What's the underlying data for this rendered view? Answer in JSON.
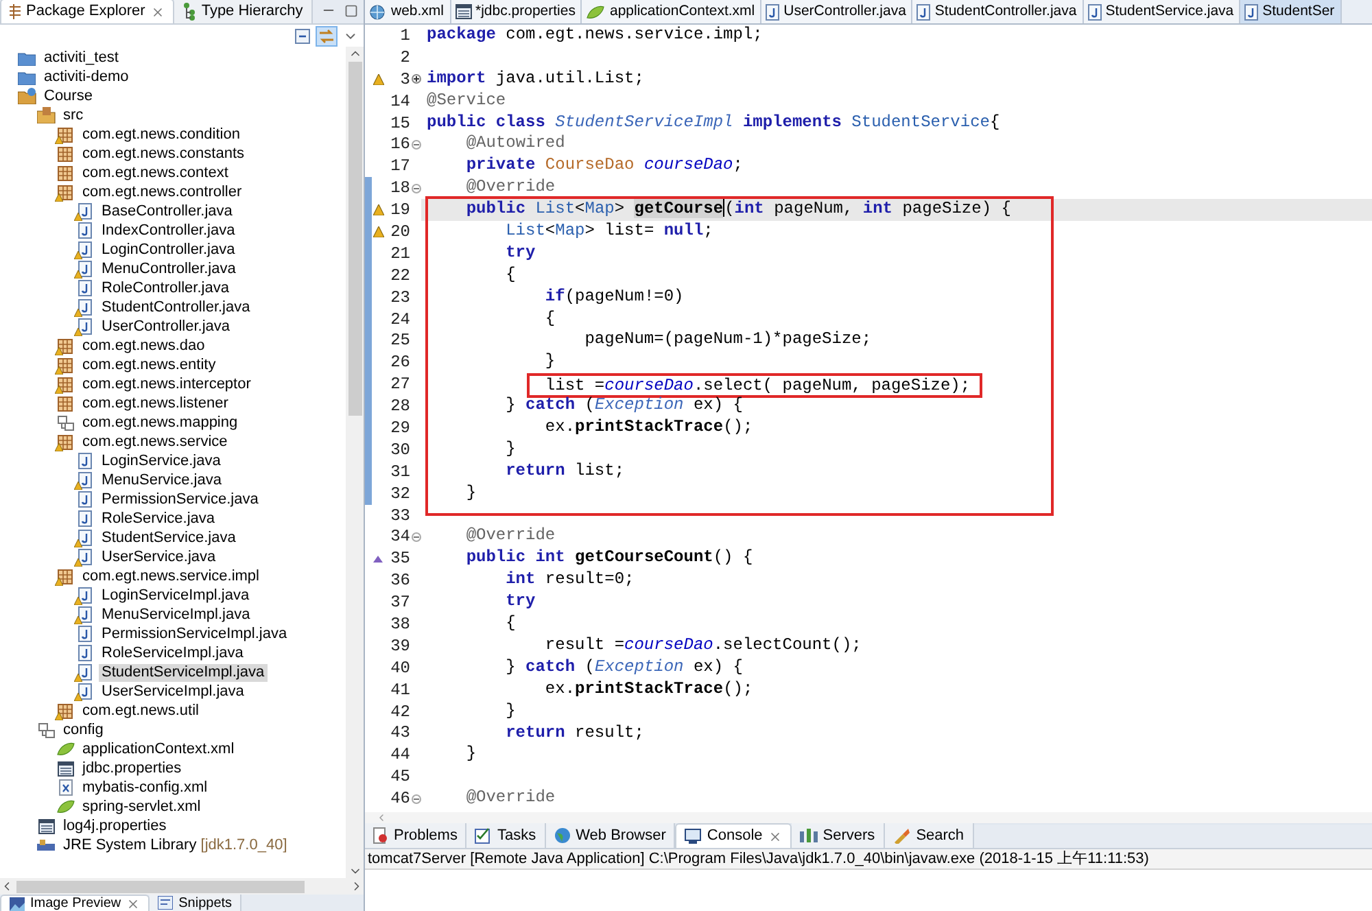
{
  "explorer": {
    "tabs": [
      {
        "label": "Package Explorer",
        "kind": "explorer",
        "selected": true,
        "closable": true
      },
      {
        "label": "Type Hierarchy",
        "kind": "hierarchy",
        "selected": false,
        "closable": false
      }
    ],
    "link_with_editor": true,
    "tree": [
      {
        "label": "activiti_test",
        "kind": "project",
        "selected": false
      },
      {
        "label": "activiti-demo",
        "kind": "project",
        "selected": false
      },
      {
        "label": "Course",
        "kind": "java_project",
        "selected": false,
        "children": [
          {
            "label": "src",
            "kind": "source_folder",
            "selected": false,
            "children": [
              {
                "label": "com.egt.news.condition",
                "kind": "package",
                "warning": true,
                "selected": false
              },
              {
                "label": "com.egt.news.constants",
                "kind": "package",
                "warning": false,
                "selected": false
              },
              {
                "label": "com.egt.news.context",
                "kind": "package",
                "warning": false,
                "selected": false
              },
              {
                "label": "com.egt.news.controller",
                "kind": "package",
                "warning": true,
                "selected": false,
                "children": [
                  {
                    "label": "BaseController.java",
                    "kind": "java",
                    "warning": true,
                    "selected": false
                  },
                  {
                    "label": "IndexController.java",
                    "kind": "java",
                    "warning": false,
                    "selected": false
                  },
                  {
                    "label": "LoginController.java",
                    "kind": "java",
                    "warning": true,
                    "selected": false
                  },
                  {
                    "label": "MenuController.java",
                    "kind": "java",
                    "warning": true,
                    "selected": false
                  },
                  {
                    "label": "RoleController.java",
                    "kind": "java",
                    "warning": false,
                    "selected": false
                  },
                  {
                    "label": "StudentController.java",
                    "kind": "java",
                    "warning": true,
                    "selected": false
                  },
                  {
                    "label": "UserController.java",
                    "kind": "java",
                    "warning": true,
                    "selected": false
                  }
                ]
              },
              {
                "label": "com.egt.news.dao",
                "kind": "package",
                "warning": true,
                "selected": false
              },
              {
                "label": "com.egt.news.entity",
                "kind": "package",
                "warning": true,
                "selected": false
              },
              {
                "label": "com.egt.news.interceptor",
                "kind": "package",
                "warning": true,
                "selected": false
              },
              {
                "label": "com.egt.news.listener",
                "kind": "package",
                "warning": false,
                "selected": false
              },
              {
                "label": "com.egt.news.mapping",
                "kind": "folder",
                "selected": false
              },
              {
                "label": "com.egt.news.service",
                "kind": "package",
                "warning": true,
                "selected": false,
                "children": [
                  {
                    "label": "LoginService.java",
                    "kind": "java",
                    "warning": false,
                    "selected": false
                  },
                  {
                    "label": "MenuService.java",
                    "kind": "java",
                    "warning": true,
                    "selected": false
                  },
                  {
                    "label": "PermissionService.java",
                    "kind": "java",
                    "warning": false,
                    "selected": false
                  },
                  {
                    "label": "RoleService.java",
                    "kind": "java",
                    "warning": false,
                    "selected": false
                  },
                  {
                    "label": "StudentService.java",
                    "kind": "java",
                    "warning": true,
                    "selected": false
                  },
                  {
                    "label": "UserService.java",
                    "kind": "java",
                    "warning": true,
                    "selected": false
                  }
                ]
              },
              {
                "label": "com.egt.news.service.impl",
                "kind": "package",
                "warning": true,
                "selected": false,
                "children": [
                  {
                    "label": "LoginServiceImpl.java",
                    "kind": "java",
                    "warning": true,
                    "selected": false
                  },
                  {
                    "label": "MenuServiceImpl.java",
                    "kind": "java",
                    "warning": true,
                    "selected": false
                  },
                  {
                    "label": "PermissionServiceImpl.java",
                    "kind": "java",
                    "warning": false,
                    "selected": false
                  },
                  {
                    "label": "RoleServiceImpl.java",
                    "kind": "java",
                    "warning": false,
                    "selected": false
                  },
                  {
                    "label": "StudentServiceImpl.java",
                    "kind": "java",
                    "warning": true,
                    "selected": true
                  },
                  {
                    "label": "UserServiceImpl.java",
                    "kind": "java",
                    "warning": true,
                    "selected": false
                  }
                ]
              },
              {
                "label": "com.egt.news.util",
                "kind": "package",
                "warning": true,
                "selected": false
              }
            ]
          },
          {
            "label": "config",
            "kind": "folder",
            "selected": false,
            "children": [
              {
                "label": "applicationContext.xml",
                "kind": "spring",
                "selected": false
              },
              {
                "label": "jdbc.properties",
                "kind": "properties",
                "selected": false
              },
              {
                "label": "mybatis-config.xml",
                "kind": "xml",
                "selected": false
              },
              {
                "label": "spring-servlet.xml",
                "kind": "spring",
                "selected": false
              }
            ]
          },
          {
            "label": "log4j.properties",
            "kind": "properties",
            "selected": false
          },
          {
            "label": "JRE System Library",
            "decoration": "[jdk1.7.0_40]",
            "kind": "library",
            "selected": false
          }
        ]
      }
    ]
  },
  "editor": {
    "tabs": [
      {
        "label": "web.xml",
        "kind": "web",
        "selected": false
      },
      {
        "label": "*jdbc.properties",
        "kind": "properties",
        "selected": false
      },
      {
        "label": "applicationContext.xml",
        "kind": "spring",
        "selected": false
      },
      {
        "label": "UserController.java",
        "kind": "java",
        "selected": false
      },
      {
        "label": "StudentController.java",
        "kind": "java",
        "selected": false
      },
      {
        "label": "StudentService.java",
        "kind": "java",
        "selected": false
      },
      {
        "label": "StudentSer",
        "kind": "java",
        "selected": true
      }
    ],
    "lines": [
      {
        "number": "1",
        "warning": false,
        "override": false,
        "changed": false,
        "current": false,
        "in_box": false,
        "boxed": false,
        "tokens": [
          {
            "kind": "kw",
            "text": "package"
          },
          {
            "kind": "plain",
            "text": " com.egt.news.service.impl;"
          }
        ]
      },
      {
        "number": "2",
        "warning": false,
        "override": false,
        "changed": false,
        "current": false,
        "in_box": false,
        "boxed": false
      },
      {
        "number": "3",
        "warning": true,
        "override": false,
        "collapsed": true,
        "changed": false,
        "current": false,
        "in_box": false,
        "boxed": false,
        "tokens": [
          {
            "kind": "kw",
            "text": "import"
          },
          {
            "kind": "plain",
            "text": " java.util.List;"
          }
        ]
      },
      {
        "number": "14",
        "warning": false,
        "override": false,
        "changed": false,
        "current": false,
        "in_box": false,
        "boxed": false,
        "tokens": [
          {
            "kind": "ann",
            "text": "@Service"
          }
        ]
      },
      {
        "number": "15",
        "warning": false,
        "override": false,
        "changed": false,
        "current": false,
        "in_box": false,
        "boxed": false,
        "tokens": [
          {
            "kind": "kw",
            "text": "public class "
          },
          {
            "kind": "type_italic",
            "text": "StudentServiceImpl "
          },
          {
            "kind": "kw",
            "text": "implements "
          },
          {
            "kind": "type",
            "text": "StudentService"
          },
          {
            "kind": "plain",
            "text": "{"
          }
        ]
      },
      {
        "number": "16",
        "warning": false,
        "override": false,
        "collapsed": false,
        "changed": false,
        "current": false,
        "in_box": false,
        "boxed": false,
        "tokens": [
          {
            "kind": "ann",
            "text": "    @Autowired"
          }
        ]
      },
      {
        "number": "17",
        "warning": false,
        "override": false,
        "changed": false,
        "current": false,
        "in_box": false,
        "boxed": false,
        "tokens": [
          {
            "kind": "kw",
            "text": "    private "
          },
          {
            "kind": "type_orange",
            "text": "CourseDao "
          },
          {
            "kind": "field",
            "text": "courseDao"
          },
          {
            "kind": "plain",
            "text": ";"
          }
        ]
      },
      {
        "number": "18",
        "warning": false,
        "override": false,
        "collapsed": false,
        "changed": true,
        "current": false,
        "in_box": false,
        "boxed": false,
        "tokens": [
          {
            "kind": "ann",
            "text": "    @Override"
          }
        ]
      },
      {
        "number": "19",
        "warning": true,
        "override": false,
        "changed": true,
        "current": true,
        "in_box": true,
        "boxed": false,
        "tokens": [
          {
            "kind": "kw",
            "text": "    public "
          },
          {
            "kind": "type",
            "text": "List"
          },
          {
            "kind": "plain",
            "text": "<"
          },
          {
            "kind": "type",
            "text": "Map"
          },
          {
            "kind": "plain",
            "text": "> "
          },
          {
            "kind": "method_hl",
            "text": "getCourse",
            "cursor": true
          },
          {
            "kind": "plain",
            "text": "("
          },
          {
            "kind": "kw",
            "text": "int"
          },
          {
            "kind": "plain",
            "text": " pageNum, "
          },
          {
            "kind": "kw",
            "text": "int"
          },
          {
            "kind": "plain",
            "text": " pageSize) {"
          }
        ]
      },
      {
        "number": "20",
        "warning": true,
        "override": false,
        "changed": true,
        "current": false,
        "in_box": true,
        "boxed": false,
        "tokens": [
          {
            "kind": "type",
            "text": "        List"
          },
          {
            "kind": "plain",
            "text": "<"
          },
          {
            "kind": "type",
            "text": "Map"
          },
          {
            "kind": "plain",
            "text": "> list= "
          },
          {
            "kind": "kw",
            "text": "null"
          },
          {
            "kind": "plain",
            "text": ";"
          }
        ]
      },
      {
        "number": "21",
        "warning": false,
        "override": false,
        "changed": true,
        "current": false,
        "in_box": true,
        "boxed": false,
        "tokens": [
          {
            "kind": "kw",
            "text": "        try"
          }
        ]
      },
      {
        "number": "22",
        "warning": false,
        "override": false,
        "changed": true,
        "current": false,
        "in_box": true,
        "boxed": false,
        "tokens": [
          {
            "kind": "plain",
            "text": "        {"
          }
        ]
      },
      {
        "number": "23",
        "warning": false,
        "override": false,
        "changed": true,
        "current": false,
        "in_box": true,
        "boxed": false,
        "tokens": [
          {
            "kind": "kw",
            "text": "            if"
          },
          {
            "kind": "plain",
            "text": "(pageNum!=0)"
          }
        ]
      },
      {
        "number": "24",
        "warning": false,
        "override": false,
        "changed": true,
        "current": false,
        "in_box": true,
        "boxed": false,
        "tokens": [
          {
            "kind": "plain",
            "text": "            {"
          }
        ]
      },
      {
        "number": "25",
        "warning": false,
        "override": false,
        "changed": true,
        "current": false,
        "in_box": true,
        "boxed": false,
        "tokens": [
          {
            "kind": "plain",
            "text": "                pageNum=(pageNum-1)*pageSize;"
          }
        ]
      },
      {
        "number": "26",
        "warning": false,
        "override": false,
        "changed": true,
        "current": false,
        "in_box": true,
        "boxed": false,
        "tokens": [
          {
            "kind": "plain",
            "text": "            }"
          }
        ]
      },
      {
        "number": "27",
        "warning": false,
        "override": false,
        "changed": true,
        "current": false,
        "in_box": true,
        "boxed": true,
        "tokens": [
          {
            "kind": "plain",
            "text": "            list ="
          },
          {
            "kind": "field",
            "text": "courseDao"
          },
          {
            "kind": "plain",
            "text": ".select( pageNum, pageSize);"
          }
        ]
      },
      {
        "number": "28",
        "warning": false,
        "override": false,
        "changed": true,
        "current": false,
        "in_box": true,
        "boxed": false,
        "tokens": [
          {
            "kind": "plain",
            "text": "        } "
          },
          {
            "kind": "kw",
            "text": "catch"
          },
          {
            "kind": "plain",
            "text": " ("
          },
          {
            "kind": "type_italic",
            "text": "Exception"
          },
          {
            "kind": "plain",
            "text": " ex) {"
          }
        ]
      },
      {
        "number": "29",
        "warning": false,
        "override": false,
        "changed": true,
        "current": false,
        "in_box": true,
        "boxed": false,
        "tokens": [
          {
            "kind": "plain",
            "text": "            ex."
          },
          {
            "kind": "method",
            "text": "printStackTrace"
          },
          {
            "kind": "plain",
            "text": "();"
          }
        ]
      },
      {
        "number": "30",
        "warning": false,
        "override": false,
        "changed": true,
        "current": false,
        "in_box": true,
        "boxed": false,
        "tokens": [
          {
            "kind": "plain",
            "text": "        }"
          }
        ]
      },
      {
        "number": "31",
        "warning": false,
        "override": false,
        "changed": true,
        "current": false,
        "in_box": true,
        "boxed": false,
        "tokens": [
          {
            "kind": "kw",
            "text": "        return"
          },
          {
            "kind": "plain",
            "text": " list;"
          }
        ]
      },
      {
        "number": "32",
        "warning": false,
        "override": false,
        "changed": true,
        "current": false,
        "in_box": true,
        "boxed": false,
        "tokens": [
          {
            "kind": "plain",
            "text": "    }"
          }
        ]
      },
      {
        "number": "33",
        "warning": false,
        "override": false,
        "changed": false,
        "current": false,
        "in_box": false,
        "boxed": false
      },
      {
        "number": "34",
        "warning": false,
        "override": false,
        "collapsed": false,
        "changed": false,
        "current": false,
        "in_box": false,
        "boxed": false,
        "tokens": [
          {
            "kind": "ann",
            "text": "    @Override"
          }
        ]
      },
      {
        "number": "35",
        "warning": false,
        "override": true,
        "changed": false,
        "current": false,
        "in_box": false,
        "boxed": false,
        "tokens": [
          {
            "kind": "kw",
            "text": "    public int "
          },
          {
            "kind": "method",
            "text": "getCourseCount"
          },
          {
            "kind": "plain",
            "text": "() {"
          }
        ]
      },
      {
        "number": "36",
        "warning": false,
        "override": false,
        "changed": false,
        "current": false,
        "in_box": false,
        "boxed": false,
        "tokens": [
          {
            "kind": "kw",
            "text": "        int"
          },
          {
            "kind": "plain",
            "text": " result=0;"
          }
        ]
      },
      {
        "number": "37",
        "warning": false,
        "override": false,
        "changed": false,
        "current": false,
        "in_box": false,
        "boxed": false,
        "tokens": [
          {
            "kind": "kw",
            "text": "        try"
          }
        ]
      },
      {
        "number": "38",
        "warning": false,
        "override": false,
        "changed": false,
        "current": false,
        "in_box": false,
        "boxed": false,
        "tokens": [
          {
            "kind": "plain",
            "text": "        {"
          }
        ]
      },
      {
        "number": "39",
        "warning": false,
        "override": false,
        "changed": false,
        "current": false,
        "in_box": false,
        "boxed": false,
        "tokens": [
          {
            "kind": "plain",
            "text": "            result ="
          },
          {
            "kind": "field",
            "text": "courseDao"
          },
          {
            "kind": "plain",
            "text": ".selectCount();"
          }
        ]
      },
      {
        "number": "40",
        "warning": false,
        "override": false,
        "changed": false,
        "current": false,
        "in_box": false,
        "boxed": false,
        "tokens": [
          {
            "kind": "plain",
            "text": "        } "
          },
          {
            "kind": "kw",
            "text": "catch"
          },
          {
            "kind": "plain",
            "text": " ("
          },
          {
            "kind": "type_italic",
            "text": "Exception"
          },
          {
            "kind": "plain",
            "text": " ex) {"
          }
        ]
      },
      {
        "number": "41",
        "warning": false,
        "override": false,
        "changed": false,
        "current": false,
        "in_box": false,
        "boxed": false,
        "tokens": [
          {
            "kind": "plain",
            "text": "            ex."
          },
          {
            "kind": "method",
            "text": "printStackTrace"
          },
          {
            "kind": "plain",
            "text": "();"
          }
        ]
      },
      {
        "number": "42",
        "warning": false,
        "override": false,
        "changed": false,
        "current": false,
        "in_box": false,
        "boxed": false,
        "tokens": [
          {
            "kind": "plain",
            "text": "        }"
          }
        ]
      },
      {
        "number": "43",
        "warning": false,
        "override": false,
        "changed": false,
        "current": false,
        "in_box": false,
        "boxed": false,
        "tokens": [
          {
            "kind": "kw",
            "text": "        return"
          },
          {
            "kind": "plain",
            "text": " result;"
          }
        ]
      },
      {
        "number": "44",
        "warning": false,
        "override": false,
        "changed": false,
        "current": false,
        "in_box": false,
        "boxed": false,
        "tokens": [
          {
            "kind": "plain",
            "text": "    }"
          }
        ]
      },
      {
        "number": "45",
        "warning": false,
        "override": false,
        "changed": false,
        "current": false,
        "in_box": false,
        "boxed": false
      },
      {
        "number": "46",
        "warning": false,
        "override": false,
        "collapsed": false,
        "changed": false,
        "current": false,
        "in_box": false,
        "boxed": false,
        "tokens": [
          {
            "kind": "ann",
            "text": "    @Override"
          }
        ]
      }
    ]
  },
  "bottom_panel": {
    "tabs": [
      {
        "label": "Problems",
        "kind": "problems",
        "selected": false,
        "closable": false
      },
      {
        "label": "Tasks",
        "kind": "tasks",
        "selected": false,
        "closable": false
      },
      {
        "label": "Web Browser",
        "kind": "browser",
        "selected": false,
        "closable": false
      },
      {
        "label": "Console",
        "kind": "console",
        "selected": true,
        "closable": true
      },
      {
        "label": "Servers",
        "kind": "servers",
        "selected": false,
        "closable": false
      },
      {
        "label": "Search",
        "kind": "search",
        "selected": false,
        "closable": false
      }
    ],
    "console_title": "tomcat7Server [Remote Java Application] C:\\Program Files\\Java\\jdk1.7.0_40\\bin\\javaw.exe (2018-1-15 上午11:11:53)"
  },
  "lower_left_panel": {
    "tabs": [
      {
        "label": "Image Preview",
        "kind": "image",
        "selected": true,
        "closable": true
      },
      {
        "label": "Snippets",
        "kind": "snippets",
        "selected": false,
        "closable": false
      }
    ]
  }
}
